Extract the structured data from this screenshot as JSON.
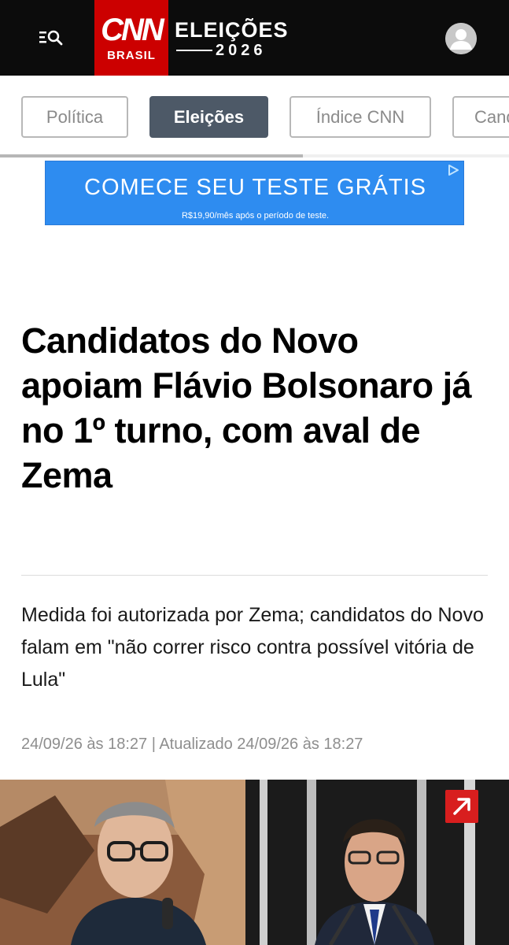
{
  "header": {
    "logo_text": "CNN",
    "logo_sub": "BRASIL",
    "section_title": "ELEIÇÕES",
    "section_year": "2026",
    "menu_icon": "menu-search-icon",
    "avatar_icon": "user-avatar-icon"
  },
  "nav": {
    "tabs": [
      {
        "label": "Política",
        "active": false
      },
      {
        "label": "Eleições",
        "active": true
      },
      {
        "label": "Índice CNN",
        "active": false
      },
      {
        "label": "Candidatos",
        "active": false
      }
    ]
  },
  "ad": {
    "title": "COMECE SEU TESTE GRÁTIS",
    "subtitle": "R$19,90/mês após o período de teste.",
    "choice_icon": "ad-choices-icon"
  },
  "article": {
    "headline": "Candidatos do Novo apoiam Flávio Bolsonaro já no 1º turno, com aval de Zema",
    "subheadline": "Medida foi autorizada por Zema; candidatos do Novo falam em \"não correr risco contra possível vitória de Lula\"",
    "dateline": "24/09/26 às 18:27 | Atualizado 24/09/26 às 18:27",
    "expand_icon": "expand-arrow-icon"
  },
  "colors": {
    "header_bg": "#0c0c0c",
    "brand_red": "#cc0000",
    "active_tab": "#4d5967",
    "ad_blue": "#2e8cf0",
    "expand_red": "#d81e1e"
  }
}
